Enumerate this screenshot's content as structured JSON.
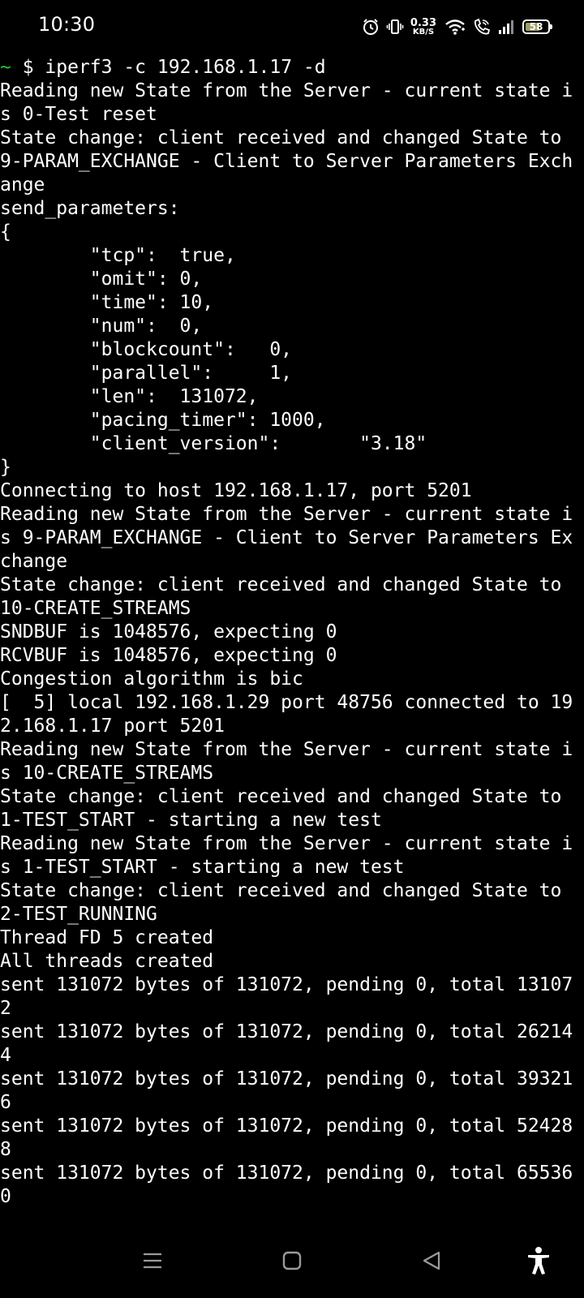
{
  "status_bar": {
    "time": "10:30",
    "net_speed_value": "0.33",
    "net_speed_unit": "KB/S",
    "battery_level": "58",
    "icons": [
      "alarm-icon",
      "vibrate-icon",
      "wifi-icon",
      "wifi-calling-icon",
      "signal-icon",
      "battery-icon"
    ]
  },
  "terminal": {
    "prompt_symbol": "~",
    "command": " $ iperf3 -c 192.168.1.17 -d",
    "lines": [
      "Reading new State from the Server - current state i",
      "s 0-Test reset",
      "State change: client received and changed State to",
      "9-PARAM_EXCHANGE - Client to Server Parameters Exch",
      "ange",
      "send_parameters:",
      "{",
      "        \"tcp\":  true,",
      "        \"omit\": 0,",
      "        \"time\": 10,",
      "        \"num\":  0,",
      "        \"blockcount\":   0,",
      "        \"parallel\":     1,",
      "        \"len\":  131072,",
      "        \"pacing_timer\": 1000,",
      "        \"client_version\":       \"3.18\"",
      "}",
      "Connecting to host 192.168.1.17, port 5201",
      "Reading new State from the Server - current state i",
      "s 9-PARAM_EXCHANGE - Client to Server Parameters Ex",
      "change",
      "State change: client received and changed State to",
      "10-CREATE_STREAMS",
      "SNDBUF is 1048576, expecting 0",
      "RCVBUF is 1048576, expecting 0",
      "Congestion algorithm is bic",
      "[  5] local 192.168.1.29 port 48756 connected to 19",
      "2.168.1.17 port 5201",
      "Reading new State from the Server - current state i",
      "s 10-CREATE_STREAMS",
      "State change: client received and changed State to",
      "1-TEST_START - starting a new test",
      "Reading new State from the Server - current state i",
      "s 1-TEST_START - starting a new test",
      "State change: client received and changed State to",
      "2-TEST_RUNNING",
      "Thread FD 5 created",
      "All threads created",
      "sent 131072 bytes of 131072, pending 0, total 13107",
      "2",
      "sent 131072 bytes of 131072, pending 0, total 26214",
      "4",
      "sent 131072 bytes of 131072, pending 0, total 39321",
      "6",
      "sent 131072 bytes of 131072, pending 0, total 52428",
      "8",
      "sent 131072 bytes of 131072, pending 0, total 65536",
      "0"
    ]
  },
  "nav_bar": {
    "buttons": [
      "recents-button",
      "home-button",
      "back-button",
      "accessibility-button"
    ]
  },
  "colors": {
    "background": "#000000",
    "text": "#ffffff",
    "prompt": "#29c23a",
    "battery_fill": "#9e9e63"
  }
}
